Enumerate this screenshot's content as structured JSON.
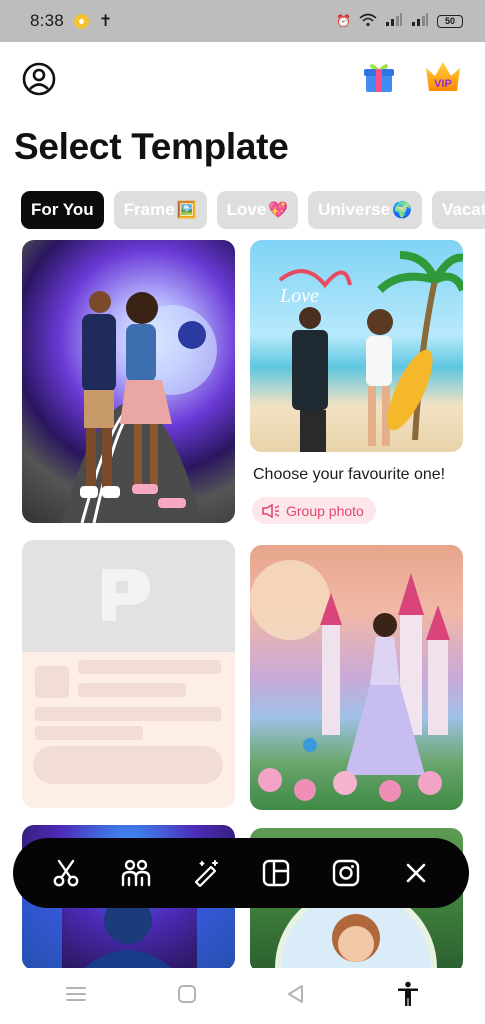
{
  "status_bar": {
    "time": "8:38",
    "battery": "50"
  },
  "header": {
    "profile_icon": "account-circle-icon",
    "gift_icon": "gift-icon",
    "vip_label": "VIP"
  },
  "title": "Select Template",
  "chips": [
    {
      "label": "For You",
      "emoji": "",
      "active": true
    },
    {
      "label": "Frame",
      "emoji": "🖼️",
      "active": false
    },
    {
      "label": "Love",
      "emoji": "💖",
      "active": false
    },
    {
      "label": "Universe",
      "emoji": "🌍",
      "active": false
    },
    {
      "label": "Vacati",
      "emoji": "",
      "active": false
    }
  ],
  "card2": {
    "caption": "Choose your favourite one!",
    "tag": "Group photo",
    "tag_icon": "speaker-icon"
  },
  "toolbar": {
    "items": [
      "scissors-icon",
      "people-icon",
      "magic-wand-icon",
      "layout-icon",
      "instagram-icon",
      "close-icon"
    ]
  },
  "nav": {
    "items": [
      "menu-icon",
      "home-square-icon",
      "back-triangle-icon",
      "accessibility-icon"
    ]
  },
  "colors": {
    "chip_active_bg": "#0c0c0c",
    "chip_inactive_bg": "#dedede",
    "tag_bg": "#fde7ea",
    "tag_text": "#e3476a",
    "toolbar_bg": "#050505"
  }
}
